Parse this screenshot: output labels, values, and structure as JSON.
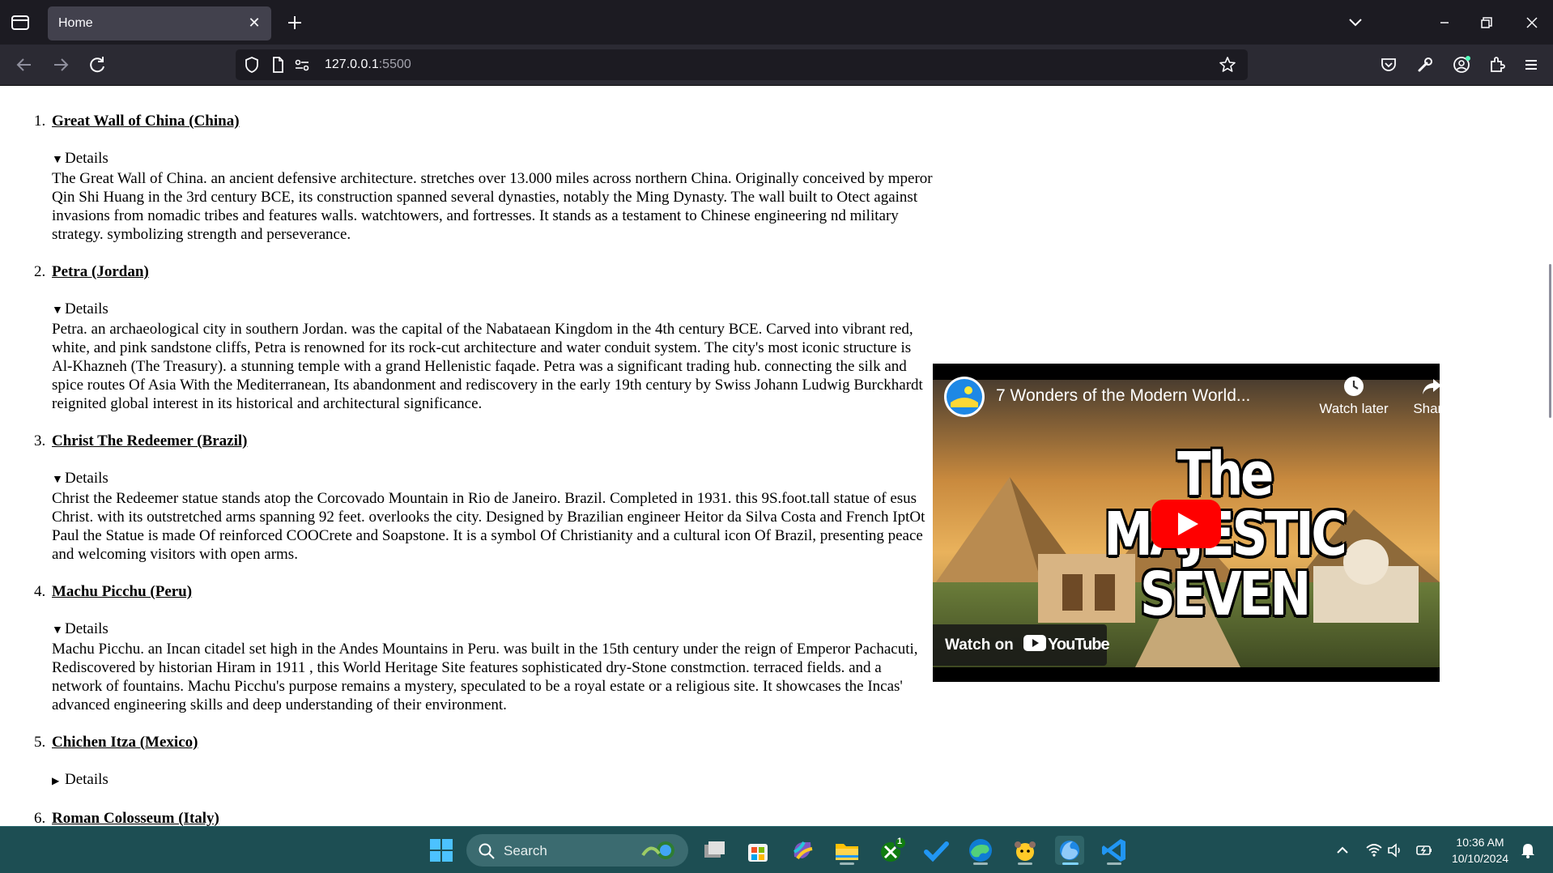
{
  "browser": {
    "tab_title": "Home",
    "url_host": "127.0.0.1",
    "url_port": ":5500"
  },
  "wonders": [
    {
      "number": "1.",
      "title": "Great Wall of China (China)",
      "open": true,
      "summary": "Details",
      "description": "The Great Wall of China. an ancient defensive architecture. stretches over 13.000 miles across northern China. Originally conceived by mperor Qin Shi Huang in the 3rd century BCE, its construction spanned several dynasties, notably the Ming Dynasty. The wall built to Otect against invasions from nomadic tribes and features walls. watchtowers, and fortresses. It stands as a testament to Chinese engineering nd military strategy. symbolizing strength and perseverance."
    },
    {
      "number": "2.",
      "title": "Petra (Jordan)",
      "open": true,
      "summary": "Details",
      "description": "Petra. an archaeological city in southern Jordan. was the capital of the Nabataean Kingdom in the 4th century BCE. Carved into vibrant red, white, and pink sandstone cliffs, Petra is renowned for its rock-cut architecture and water conduit system. The city's most iconic structure is Al-Khazneh (The Treasury). a stunning temple with a grand Hellenistic faqade. Petra was a significant trading hub. connecting the silk and spice routes Of Asia With the Mediterranean, Its abandonment and rediscovery in the early 19th century by Swiss Johann Ludwig Burckhardt reignited global interest in its historical and architectural significance."
    },
    {
      "number": "3.",
      "title": "Christ The Redeemer (Brazil)",
      "open": true,
      "summary": "Details",
      "description": "Christ the Redeemer statue stands atop the Corcovado Mountain in Rio de Janeiro. Brazil. Completed in 1931. this 9S.foot.tall statue of esus Christ. with its outstretched arms spanning 92 feet. overlooks the city. Designed by Brazilian engineer Heitor da Silva Costa and French IptOt Paul the Statue is made Of reinforced COOCrete and Soapstone. It is a symbol Of Christianity and a cultural icon Of Brazil, presenting peace and welcoming visitors with open arms."
    },
    {
      "number": "4.",
      "title": "Machu Picchu (Peru)",
      "open": true,
      "summary": "Details",
      "description": "Machu Picchu. an Incan citadel set high in the Andes Mountains in Peru. was built in the 15th century under the reign of Emperor Pachacuti, Rediscovered by historian Hiram in 1911 , this World Heritage Site features sophisticated dry-Stone constmction. terraced fields. and a network of fountains. Machu Picchu's purpose remains a mystery, speculated to be a royal estate or a religious site. It showcases the Incas' advanced engineering skills and deep understanding of their environment."
    },
    {
      "number": "5.",
      "title": "Chichen Itza (Mexico)",
      "open": false,
      "summary": "Details",
      "description": ""
    },
    {
      "number": "6.",
      "title": "Roman Colosseum (Italy)",
      "open": false,
      "summary": "",
      "description": ""
    }
  ],
  "video": {
    "title": "7 Wonders of the Modern World...",
    "watch_later": "Watch later",
    "share": "Share",
    "thumb_line1": "The MAJESTIC",
    "thumb_line2": "SEVEN",
    "watch_on": "Watch on",
    "youtube": "YouTube"
  },
  "taskbar": {
    "search_placeholder": "Search",
    "time": "10:36 AM",
    "date": "10/10/2024",
    "xbox_badge": "1"
  },
  "colors": {
    "tabbar_bg": "#1c1b22",
    "toolbar_bg": "#2b2a33",
    "taskbar_bg": "#1d4e53",
    "youtube_red": "#ff0000"
  }
}
